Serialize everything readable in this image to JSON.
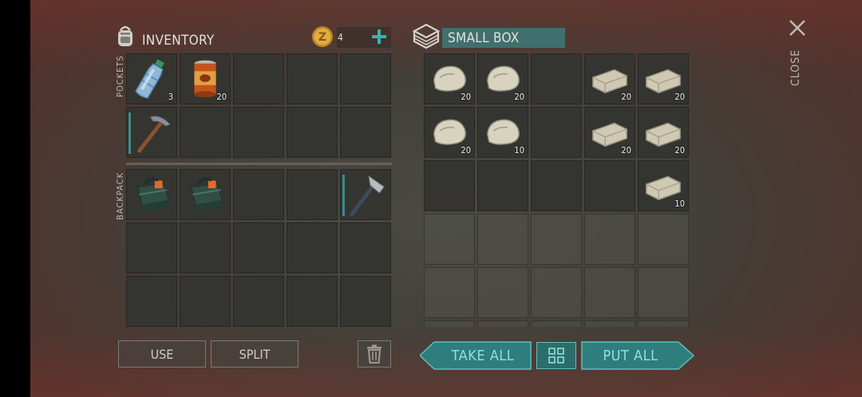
{
  "inventory": {
    "title": "INVENTORY",
    "coins": "4",
    "pockets_label": "POCKETS",
    "backpack_label": "BACKPACK",
    "pockets": [
      {
        "item": "water-bottle",
        "qty": "3"
      },
      {
        "item": "canned-food",
        "qty": "20"
      },
      {
        "item": null,
        "qty": ""
      },
      {
        "item": null,
        "qty": ""
      },
      {
        "item": null,
        "qty": ""
      },
      {
        "item": "pickaxe",
        "qty": "",
        "equipped": true
      },
      {
        "item": null,
        "qty": ""
      },
      {
        "item": null,
        "qty": ""
      },
      {
        "item": null,
        "qty": ""
      },
      {
        "item": null,
        "qty": ""
      }
    ],
    "backpack": [
      {
        "item": "first-aid-bag",
        "qty": ""
      },
      {
        "item": "first-aid-bag",
        "qty": ""
      },
      {
        "item": null,
        "qty": ""
      },
      {
        "item": null,
        "qty": ""
      },
      {
        "item": "hatchet",
        "qty": "",
        "equipped": true
      },
      {
        "item": null,
        "qty": ""
      },
      {
        "item": null,
        "qty": ""
      },
      {
        "item": null,
        "qty": ""
      },
      {
        "item": null,
        "qty": ""
      },
      {
        "item": null,
        "qty": ""
      },
      {
        "item": null,
        "qty": ""
      },
      {
        "item": null,
        "qty": ""
      },
      {
        "item": null,
        "qty": ""
      },
      {
        "item": null,
        "qty": ""
      },
      {
        "item": null,
        "qty": ""
      }
    ],
    "use_label": "USE",
    "split_label": "SPLIT"
  },
  "box": {
    "title": "SMALL BOX",
    "close_label": "CLOSE",
    "slots": [
      {
        "item": "stone",
        "qty": "20"
      },
      {
        "item": "stone",
        "qty": "20"
      },
      {
        "item": null,
        "qty": ""
      },
      {
        "item": "stone-brick",
        "qty": "20"
      },
      {
        "item": "stone-brick",
        "qty": "20"
      },
      {
        "item": "stone",
        "qty": "20"
      },
      {
        "item": "stone",
        "qty": "10"
      },
      {
        "item": null,
        "qty": ""
      },
      {
        "item": "stone-brick",
        "qty": "20"
      },
      {
        "item": "stone-brick",
        "qty": "20"
      },
      {
        "item": null,
        "qty": ""
      },
      {
        "item": null,
        "qty": ""
      },
      {
        "item": null,
        "qty": ""
      },
      {
        "item": null,
        "qty": ""
      },
      {
        "item": "stone-brick",
        "qty": "10"
      }
    ],
    "take_all_label": "TAKE ALL",
    "put_all_label": "PUT ALL"
  },
  "colors": {
    "accent": "#2e7e7e",
    "accent_text": "#8fe0df",
    "slot": "#343430"
  }
}
